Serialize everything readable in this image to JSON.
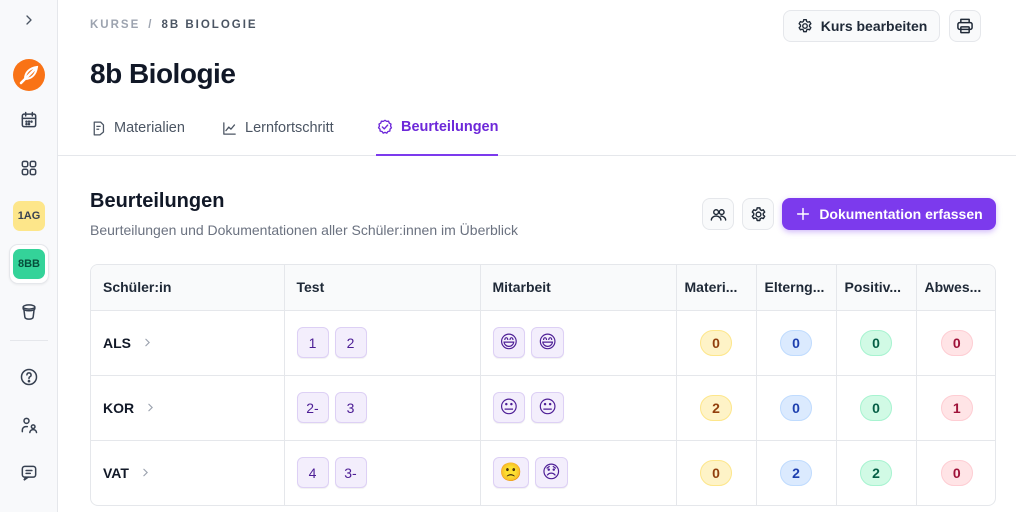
{
  "breadcrumb": {
    "root": "KURSE",
    "separator": "/",
    "current": "8B BIOLOGIE"
  },
  "header": {
    "edit_label": "Kurs bearbeiten",
    "title": "8b Biologie"
  },
  "sidebar": {
    "courses": [
      {
        "label": "1AG",
        "color": "#fde68a"
      },
      {
        "label": "8BB",
        "color": "#34d399"
      }
    ]
  },
  "tabs": [
    {
      "label": "Materialien",
      "icon": "document-icon"
    },
    {
      "label": "Lernfortschritt",
      "icon": "chart-line-icon"
    },
    {
      "label": "Beurteilungen",
      "icon": "badge-check-icon",
      "active": true
    }
  ],
  "section": {
    "title": "Beurteilungen",
    "subtitle": "Beurteilungen und Dokumentationen aller Schüler:innen im Überblick",
    "primary_label": "Dokumentation erfassen"
  },
  "table": {
    "columns": [
      "Schüler:in",
      "Test",
      "Mitarbeit",
      "Materi...",
      "Elterng...",
      "Positiv...",
      "Abwes..."
    ],
    "rows": [
      {
        "student": "ALS",
        "test": [
          "1",
          "2"
        ],
        "mitarbeit": [
          "😄",
          "😄"
        ],
        "materialien": "0",
        "elterngespraech": "0",
        "positiv": "0",
        "abwesenheit": "0"
      },
      {
        "student": "KOR",
        "test": [
          "2-",
          "3"
        ],
        "mitarbeit": [
          "😐",
          "😐"
        ],
        "materialien": "2",
        "elterngespraech": "0",
        "positiv": "0",
        "abwesenheit": "1"
      },
      {
        "student": "VAT",
        "test": [
          "4",
          "3-"
        ],
        "mitarbeit": [
          "🙁",
          "😞"
        ],
        "materialien": "0",
        "elterngespraech": "2",
        "positiv": "2",
        "abwesenheit": "0"
      }
    ]
  },
  "colors": {
    "accent": "#7c3aed",
    "materialien": "#fef3c7",
    "elterngespraech": "#dbeafe",
    "positiv": "#d1fae5",
    "abwesenheit": "#ffe4e6"
  }
}
